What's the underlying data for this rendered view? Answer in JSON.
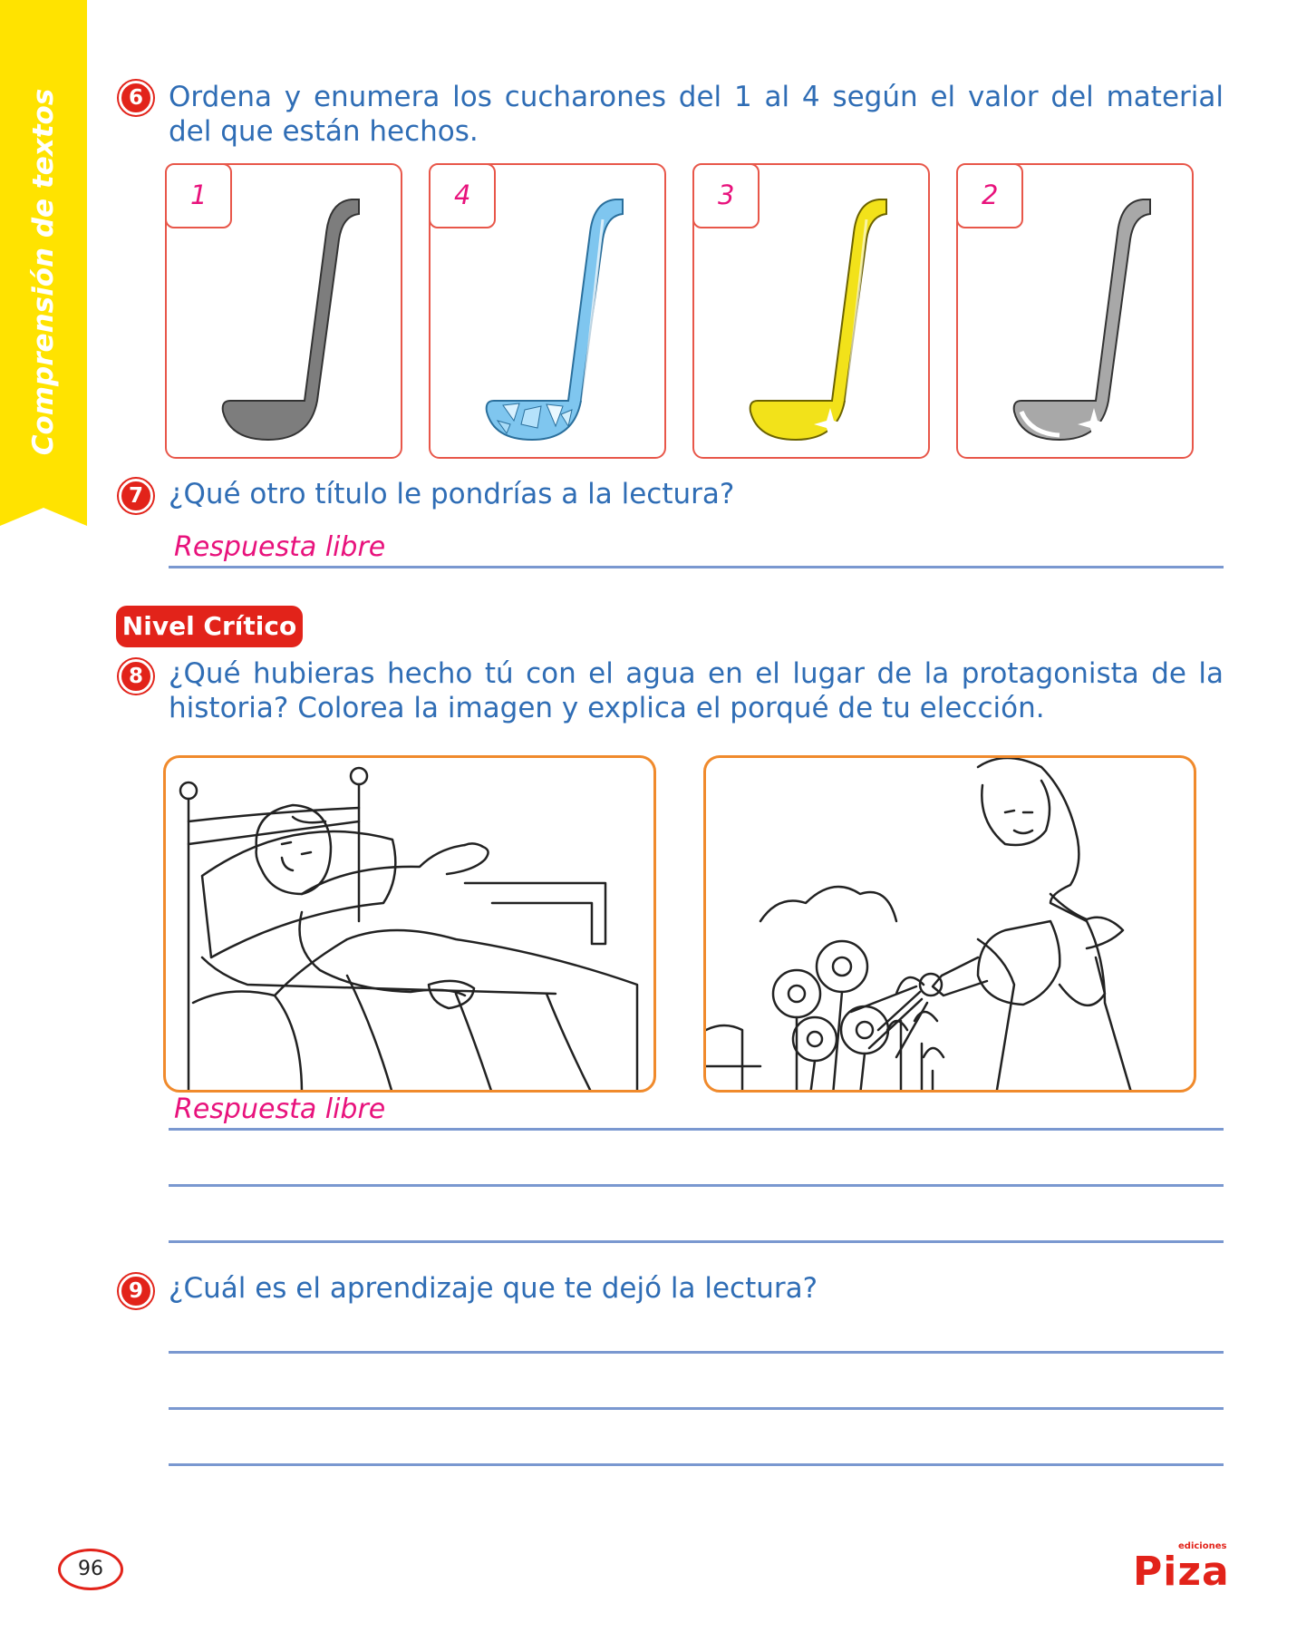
{
  "side_tab": {
    "label": "Comprensión de textos",
    "color": "#ffe300"
  },
  "q6": {
    "number": "6",
    "text": "Ordena y enumera los cucharones del 1 al 4 según el valor del material del que están hechos.",
    "ladles": [
      {
        "number": "1",
        "color": "gray-ladle-icon"
      },
      {
        "number": "4",
        "color": "diamond-ladle-icon"
      },
      {
        "number": "3",
        "color": "gold-ladle-icon"
      },
      {
        "number": "2",
        "color": "silver-ladle-icon"
      }
    ]
  },
  "q7": {
    "number": "7",
    "text": "¿Qué otro título le pondrías a la lectura?",
    "answer": "Respuesta libre"
  },
  "section_badge": {
    "label": "Nivel Crítico"
  },
  "q8": {
    "number": "8",
    "text": "¿Qué hubieras hecho tú con el agua en el lugar de la protagonista de la historia? Colorea la imagen y explica el porqué de tu elección.",
    "images": [
      "sick-person-in-bed-illustration",
      "girl-watering-flowers-illustration"
    ],
    "answer": "Respuesta libre"
  },
  "q9": {
    "number": "9",
    "text": "¿Cuál es el aprendizaje que te dejó la lectura?"
  },
  "footer": {
    "page_number": "96",
    "logo_small": "ediciones",
    "logo_main": "Piza"
  }
}
